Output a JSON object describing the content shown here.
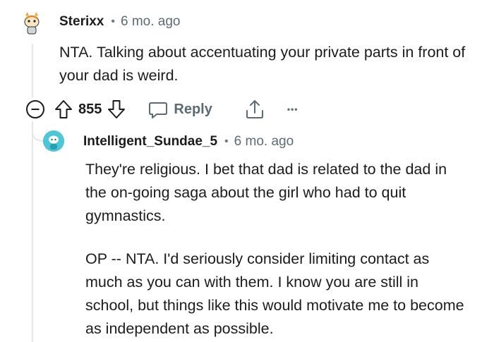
{
  "comments": [
    {
      "author": "Sterixx",
      "separator": "•",
      "time": "6 mo. ago",
      "body": [
        "NTA. Talking about accentuating your private parts in front of your dad is weird."
      ],
      "score": "855",
      "reply_label": "Reply",
      "avatar_icon": "snoo-avatar-orange",
      "more_label": "•••"
    },
    {
      "author": "Intelligent_Sundae_5",
      "separator": "•",
      "time": "6 mo. ago",
      "body": [
        "They're religious. I bet that dad is related to the dad in the on-going saga about the girl who had to quit gymnastics.",
        "OP -- NTA. I'd seriously consider limiting contact as much as you can with them. I know you are still in school, but things like this would motivate me to become as independent as possible."
      ],
      "avatar_icon": "snoo-avatar-teal"
    }
  ],
  "icons": {
    "collapse": "collapse-icon",
    "upvote": "upvote-icon",
    "downvote": "downvote-icon",
    "reply": "reply-icon",
    "share": "share-icon"
  },
  "colors": {
    "text": "#1c1c1c",
    "meta": "#5c6c74",
    "icon": "#1c1c1c",
    "thread_line": "#e5e8ea",
    "avatar_teal": "#4dc7d8"
  }
}
